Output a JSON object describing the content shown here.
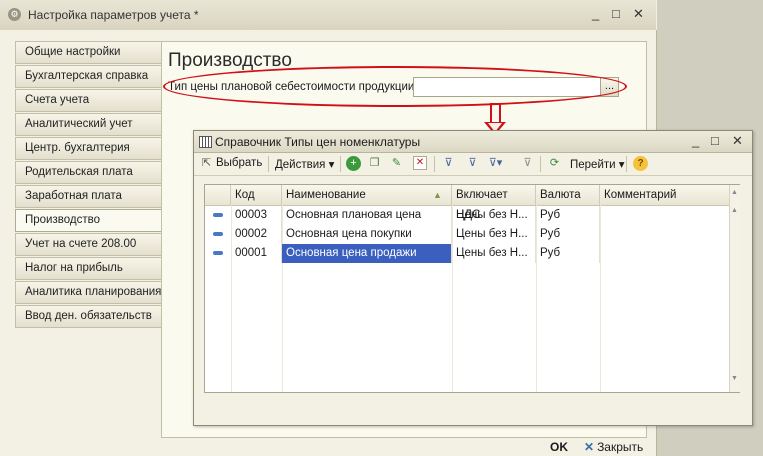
{
  "window": {
    "title": "Настройка параметров учета *",
    "buttons": [
      "_",
      "□",
      "✕"
    ]
  },
  "tabs": [
    "Общие настройки",
    "Бухгалтерская справка",
    "Счета учета",
    "Аналитический учет",
    "Центр. бухгалтерия",
    "Родительская плата",
    "Заработная плата",
    "Производство",
    "Учет на счете 208.00",
    "Налог на прибыль",
    "Аналитика планирования",
    "Ввод ден. обязательств"
  ],
  "active_tab": "Производство",
  "section": {
    "title": "Производство",
    "field_label": "Тип цены плановой себестоимости продукции:",
    "field_value": "",
    "field_button": "..."
  },
  "footer": {
    "ok": "OK",
    "close": "Закрыть"
  },
  "dialog": {
    "title": "Справочник Типы цен номенклатуры",
    "toolbar": {
      "select": "Выбрать",
      "actions": "Действия",
      "go": "Перейти"
    },
    "columns": [
      "Код",
      "Наименование",
      "Включает НДС",
      "Валюта",
      "Комментарий"
    ],
    "rows": [
      {
        "code": "00003",
        "name": "Основная плановая цена",
        "vat": "Цены без Н...",
        "currency": "Руб",
        "comment": ""
      },
      {
        "code": "00002",
        "name": "Основная цена покупки",
        "vat": "Цены без Н...",
        "currency": "Руб",
        "comment": ""
      },
      {
        "code": "00001",
        "name": "Основная цена продажи",
        "vat": "Цены без Н...",
        "currency": "Руб",
        "comment": ""
      }
    ]
  },
  "colors": {
    "annotation": "#d10f16",
    "selection": "#3b5fbf"
  }
}
